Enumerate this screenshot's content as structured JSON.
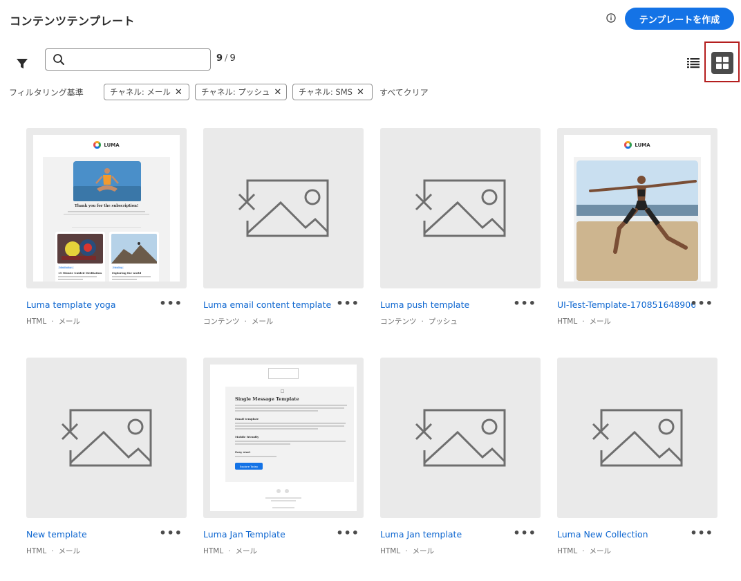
{
  "header": {
    "title": "コンテンツテンプレート",
    "create_button": "テンプレートを作成"
  },
  "toolbar": {
    "search_value": "",
    "search_placeholder": "",
    "count_shown": "9",
    "count_separator": "/",
    "count_total": "9"
  },
  "filters": {
    "label": "フィルタリング基準",
    "chips": [
      {
        "label": "チャネル: メール"
      },
      {
        "label": "チャネル: プッシュ"
      },
      {
        "label": "チャネル: SMS"
      }
    ],
    "clear_all": "すべてクリア"
  },
  "cards": [
    {
      "title": "Luma template yoga",
      "type": "HTML",
      "channel": "メール",
      "thumbnail": "email-yoga"
    },
    {
      "title": "Luma email content template",
      "type": "コンテンツ",
      "channel": "メール",
      "thumbnail": "placeholder"
    },
    {
      "title": "Luma push template",
      "type": "コンテンツ",
      "channel": "プッシュ",
      "thumbnail": "placeholder"
    },
    {
      "title": "UI-Test-Template-170851648906...",
      "type": "HTML",
      "channel": "メール",
      "thumbnail": "email-beach"
    },
    {
      "title": "New template",
      "type": "HTML",
      "channel": "メール",
      "thumbnail": "placeholder"
    },
    {
      "title": "Luma Jan Template",
      "type": "HTML",
      "channel": "メール",
      "thumbnail": "email-single-message"
    },
    {
      "title": "Luma Jan template",
      "type": "HTML",
      "channel": "メール",
      "thumbnail": "placeholder"
    },
    {
      "title": "Luma New Collection",
      "type": "HTML",
      "channel": "メール",
      "thumbnail": "placeholder"
    }
  ],
  "thumbnails": {
    "yoga": {
      "logo": "LUMA",
      "heading": "Thank you for the subscription!",
      "tag1": "Meditation",
      "item1": "15 Minute Guided Meditation",
      "tag2": "Healing",
      "item2": "Exploring the world"
    },
    "beach": {
      "logo": "LUMA"
    },
    "single": {
      "heading": "Single Message Template",
      "s1": "Email template",
      "s2": "Mobile friendly",
      "s3": "Easy start",
      "button": "Explore Today"
    }
  },
  "colors": {
    "accent": "#1473e6",
    "link": "#0d66d0",
    "highlight_border": "#b41e1e",
    "thumb_bg": "#eaeaea"
  },
  "icons": [
    "info-icon",
    "filter-icon",
    "search-icon",
    "list-view-icon",
    "grid-view-icon",
    "close-icon",
    "more-icon",
    "image-placeholder-icon"
  ]
}
